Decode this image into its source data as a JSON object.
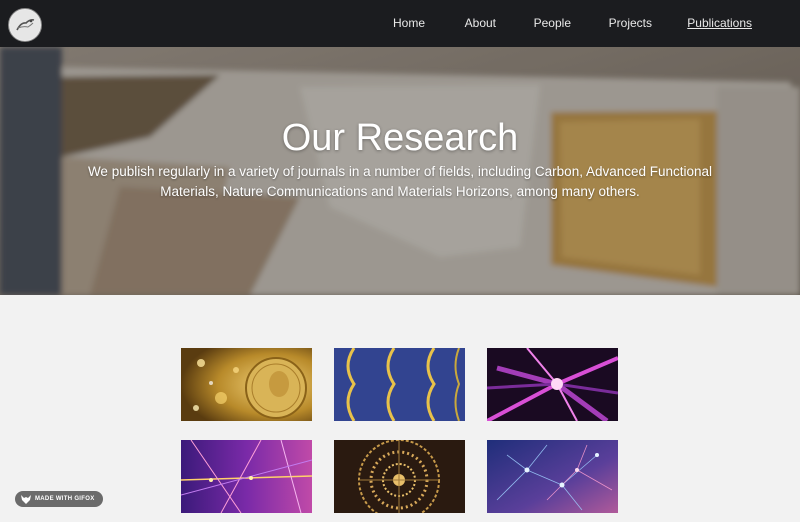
{
  "nav": {
    "home": "Home",
    "about": "About",
    "people": "People",
    "projects": "Projects",
    "publications": "Publications"
  },
  "hero": {
    "title": "Our Research",
    "subtitle": "We publish regularly in a variety of journals in a number of fields, including Carbon, Advanced Functional Materials, Nature Communications and Materials Horizons, among many others."
  },
  "gallery": {
    "tiles": [
      {
        "name": "gold-medal-particles"
      },
      {
        "name": "blue-yellow-waves"
      },
      {
        "name": "purple-vortex"
      },
      {
        "name": "violet-particle-traces"
      },
      {
        "name": "radial-gold-pattern"
      },
      {
        "name": "blue-pink-network"
      }
    ]
  },
  "badge": {
    "text": "MADE WITH GIFOX",
    "icon": "fox-icon"
  },
  "colors": {
    "topbar": "#1b1c1f",
    "page_bg": "#f2f2f2",
    "nav_text": "#e9e9e9"
  }
}
